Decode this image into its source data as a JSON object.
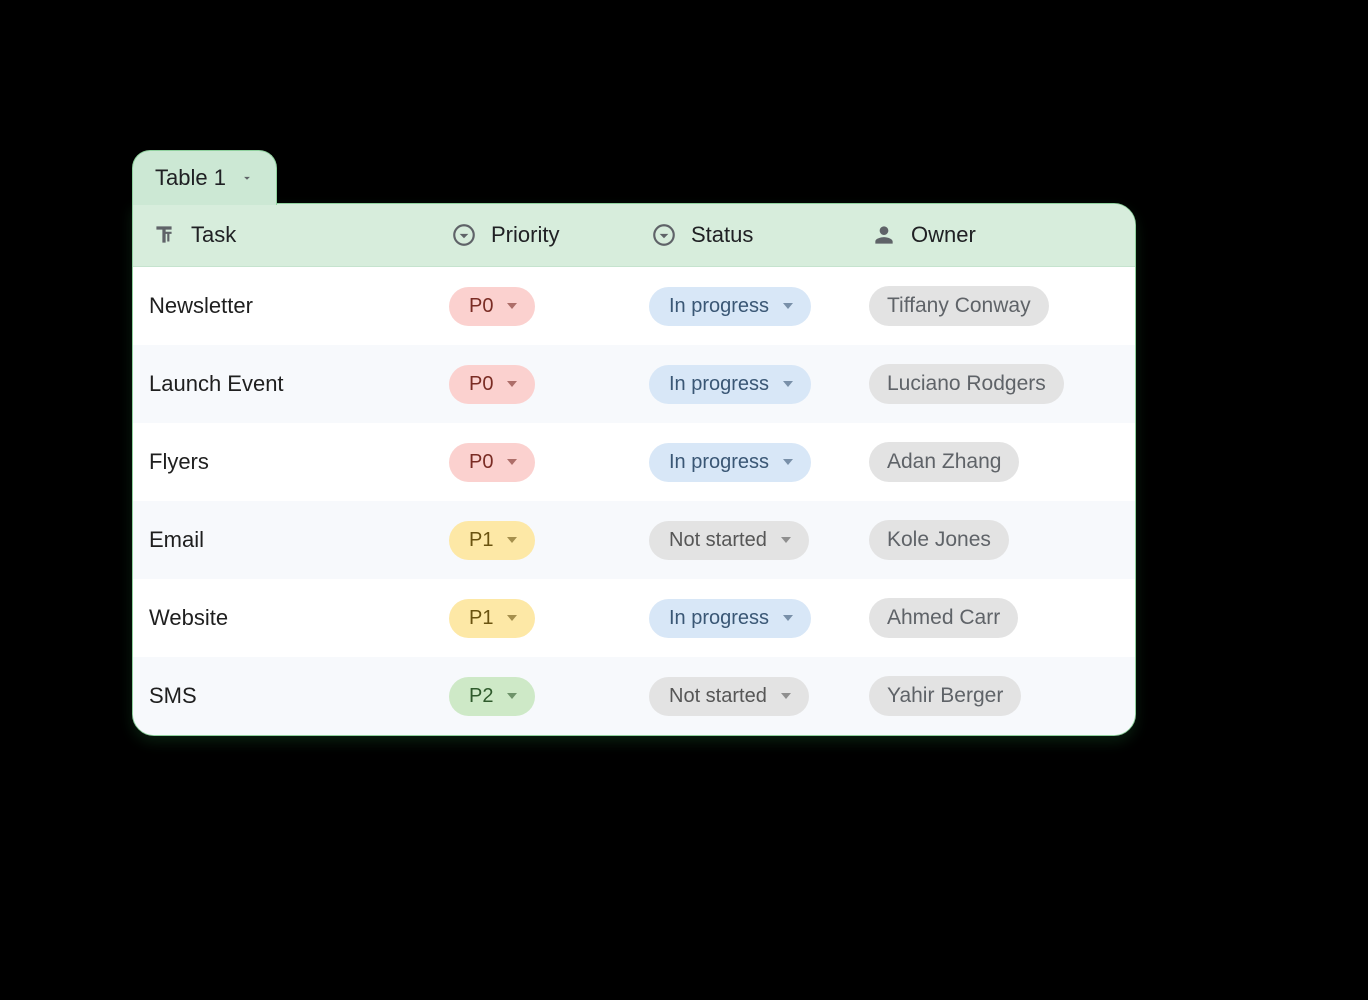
{
  "colors": {
    "prio_p0_bg": "#fbd1cf",
    "prio_p0_fg": "#7a2c24",
    "prio_p1_bg": "#fde8a6",
    "prio_p1_fg": "#6a5310",
    "prio_p2_bg": "#cee9c7",
    "prio_p2_fg": "#2f5a2c",
    "status_inprog_bg": "#d8e7f7",
    "status_inprog_fg": "#3a5775",
    "status_notstarted_bg": "#e3e3e3",
    "status_notstarted_fg": "#565656"
  },
  "tab": {
    "label": "Table 1"
  },
  "columns": {
    "task": "Task",
    "priority": "Priority",
    "status": "Status",
    "owner": "Owner"
  },
  "rows": [
    {
      "task": "Newsletter",
      "priority": "P0",
      "status": "In progress",
      "owner": "Tiffany Conway"
    },
    {
      "task": "Launch Event",
      "priority": "P0",
      "status": "In progress",
      "owner": "Luciano Rodgers"
    },
    {
      "task": "Flyers",
      "priority": "P0",
      "status": "In progress",
      "owner": "Adan Zhang"
    },
    {
      "task": "Email",
      "priority": "P1",
      "status": "Not started",
      "owner": "Kole Jones"
    },
    {
      "task": "Website",
      "priority": "P1",
      "status": "In progress",
      "owner": "Ahmed Carr"
    },
    {
      "task": "SMS",
      "priority": "P2",
      "status": "Not started",
      "owner": "Yahir Berger"
    }
  ]
}
